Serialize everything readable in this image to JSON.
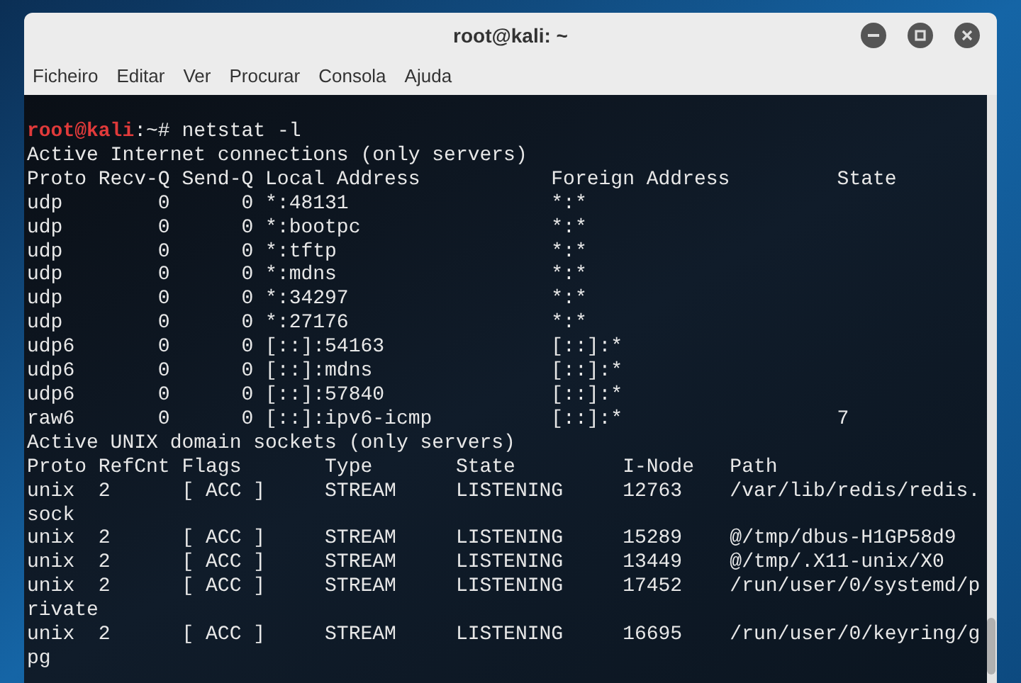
{
  "window": {
    "title": "root@kali: ~"
  },
  "menu": [
    "Ficheiro",
    "Editar",
    "Ver",
    "Procurar",
    "Consola",
    "Ajuda"
  ],
  "terminal": {
    "prompt": {
      "user_host": "root@kali",
      "rest": ":~# netstat -l"
    },
    "lines": [
      "Active Internet connections (only servers)",
      "Proto Recv-Q Send-Q Local Address           Foreign Address         State",
      "udp        0      0 *:48131                 *:*",
      "udp        0      0 *:bootpc                *:*",
      "udp        0      0 *:tftp                  *:*",
      "udp        0      0 *:mdns                  *:*",
      "udp        0      0 *:34297                 *:*",
      "udp        0      0 *:27176                 *:*",
      "udp6       0      0 [::]:54163              [::]:*",
      "udp6       0      0 [::]:mdns               [::]:*",
      "udp6       0      0 [::]:57840              [::]:*",
      "raw6       0      0 [::]:ipv6-icmp          [::]:*                  7",
      "Active UNIX domain sockets (only servers)",
      "Proto RefCnt Flags       Type       State         I-Node   Path",
      "unix  2      [ ACC ]     STREAM     LISTENING     12763    /var/lib/redis/redis.",
      "sock",
      "unix  2      [ ACC ]     STREAM     LISTENING     15289    @/tmp/dbus-H1GP58d9",
      "unix  2      [ ACC ]     STREAM     LISTENING     13449    @/tmp/.X11-unix/X0",
      "unix  2      [ ACC ]     STREAM     LISTENING     17452    /run/user/0/systemd/p",
      "rivate",
      "unix  2      [ ACC ]     STREAM     LISTENING     16695    /run/user/0/keyring/g",
      "pg"
    ]
  }
}
